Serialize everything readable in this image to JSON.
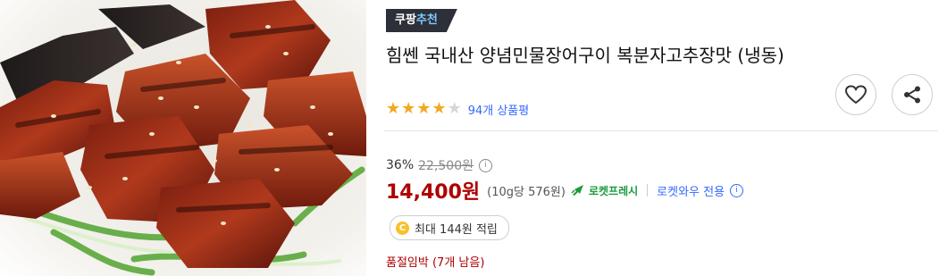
{
  "product": {
    "badge_prefix": "쿠팡",
    "badge_suffix": "추천",
    "title": "힘쎈 국내산 양념민물장어구이 복분자고추장맛 (냉동)",
    "rating": {
      "stars_filled": 4,
      "stars_total": 5,
      "review_count": "94개 상품평"
    },
    "discount_rate": "36%",
    "original_price": "22,500원",
    "sale_price": "14,400원",
    "unit_price": "(10g당 576원)",
    "rocket_label": "로켓프레시",
    "member_label": "로켓와우 전용",
    "reward_coin": "C",
    "reward_text": "최대 144원 적립",
    "stock_text": "품절임박 (7개 남음)"
  },
  "icons": {
    "wishlist": "heart-icon",
    "share": "share-icon",
    "info": "info-icon",
    "rocket": "rocket-icon"
  },
  "colors": {
    "price_red": "#ae0000",
    "review_blue": "#346aff",
    "star_gold": "#f5a623",
    "rocket_green": "#1b9b3e",
    "badge_bg": "#2d3038"
  }
}
